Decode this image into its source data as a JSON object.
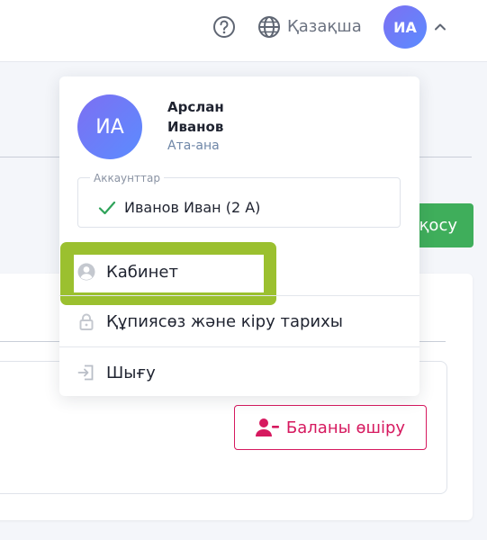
{
  "topbar": {
    "help_icon": "question-circle-icon",
    "globe_icon": "globe-icon",
    "language": "Қазақша",
    "avatar_initials": "ИА",
    "chevron_icon": "chevron-up-icon"
  },
  "background": {
    "green_button_label": "қосу",
    "remove_child_label": "Баланы өшіру",
    "remove_child_icon": "user-minus-icon"
  },
  "dropdown": {
    "avatar_initials": "ИА",
    "first_name": "Арслан",
    "last_name": "Иванов",
    "role": "Ата-ана",
    "accounts_legend": "Аккаунттар",
    "accounts": [
      {
        "label": "Иванов Иван (2 А)",
        "selected": true
      }
    ],
    "menu": [
      {
        "label": "Кабинет",
        "icon": "user-circle-icon"
      },
      {
        "label": "Құпиясөз және кіру тарихы",
        "icon": "lock-icon"
      },
      {
        "label": "Шығу",
        "icon": "logout-icon"
      }
    ]
  },
  "colors": {
    "accent_purple": "#6f73f0",
    "green": "#3fae5b",
    "danger": "#d6195f",
    "highlight": "#9bc02f"
  }
}
